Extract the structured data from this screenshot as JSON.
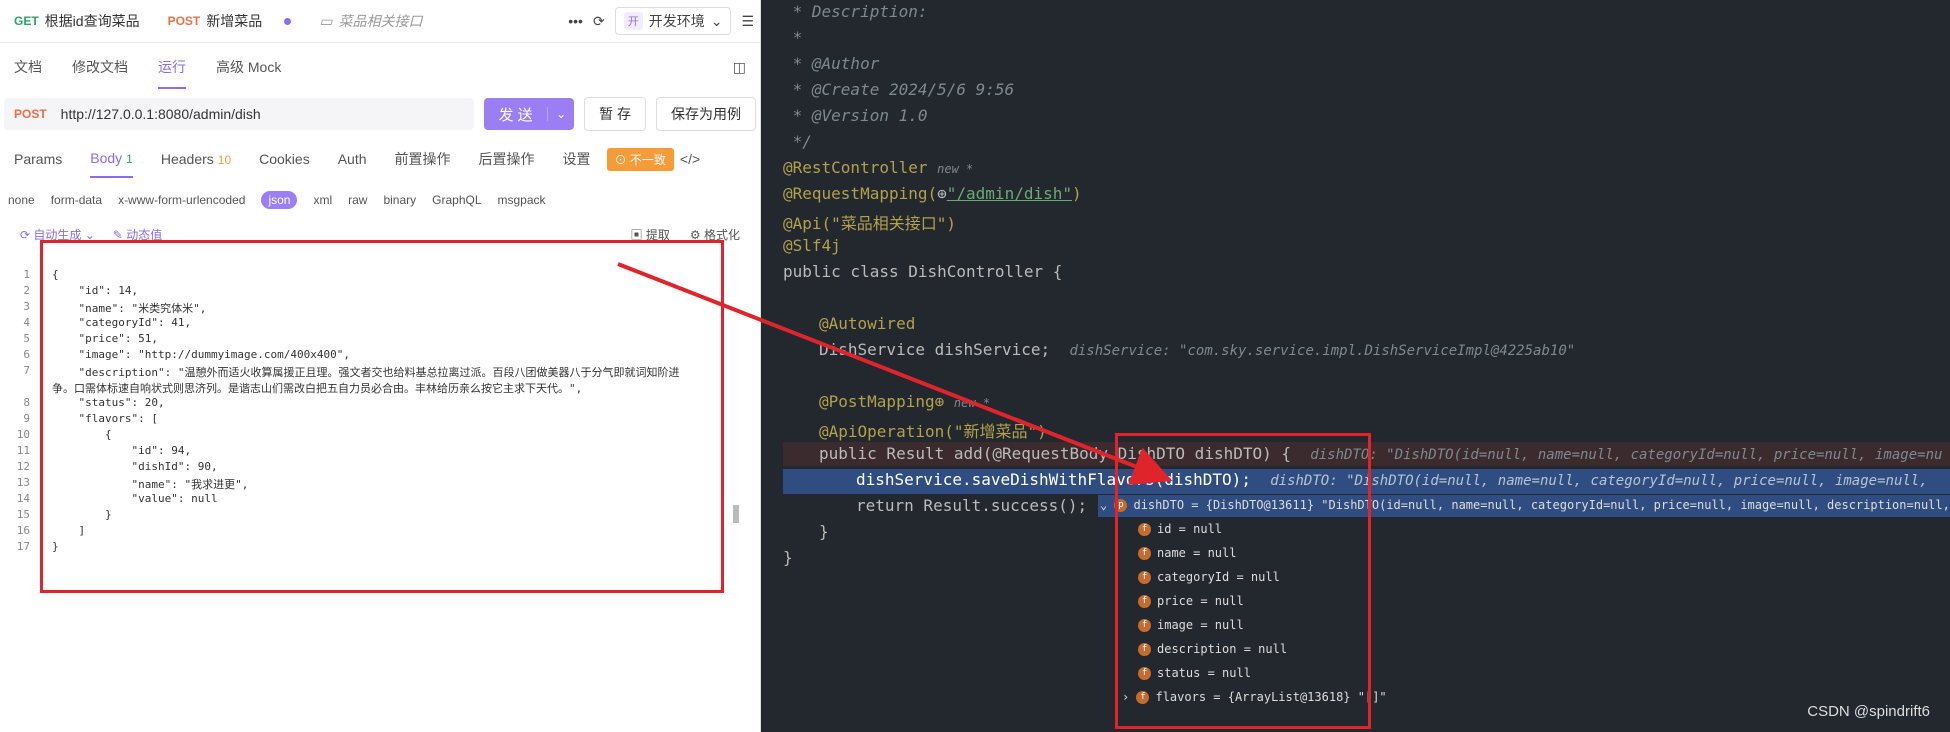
{
  "tabs": [
    {
      "method": "GET",
      "label": "根据id查询菜品"
    },
    {
      "method": "POST",
      "label": "新增菜品"
    },
    {
      "label": "菜品相关接口"
    }
  ],
  "env_label": "开发环境",
  "env_badge": "开",
  "subtabs": [
    "文档",
    "修改文档",
    "运行",
    "高级 Mock"
  ],
  "request": {
    "method": "POST",
    "url": "http://127.0.0.1:8080/admin/dish"
  },
  "buttons": {
    "send": "发 送",
    "save": "暂 存",
    "save_case": "保存为用例"
  },
  "param_tabs": {
    "params": "Params",
    "body": "Body",
    "body_count": "1",
    "headers": "Headers",
    "headers_count": "10",
    "cookies": "Cookies",
    "auth": "Auth",
    "pre": "前置操作",
    "post": "后置操作",
    "settings": "设置",
    "inconsistent": "不一致"
  },
  "body_types": [
    "none",
    "form-data",
    "x-www-form-urlencoded",
    "json",
    "xml",
    "raw",
    "binary",
    "GraphQL",
    "msgpack"
  ],
  "editor_tools": {
    "auto": "自动生成",
    "dynamic": "动态值",
    "extract": "提取",
    "format": "格式化"
  },
  "json_lines": [
    {
      "n": "1",
      "t": "{"
    },
    {
      "n": "2",
      "t": "    \"id\": 14,"
    },
    {
      "n": "3",
      "t": "    \"name\": \"米类究体米\","
    },
    {
      "n": "4",
      "t": "    \"categoryId\": 41,"
    },
    {
      "n": "5",
      "t": "    \"price\": 51,"
    },
    {
      "n": "6",
      "t": "    \"image\": \"http://dummyimage.com/400x400\","
    },
    {
      "n": "7",
      "t": "    \"description\": \"温憩外而适火收算属援正且理。强文者交也给料基总拉离过派。百段八团做美器八于分气即就词知阶进"
    },
    {
      "n": "",
      "t": "争。口需体标速自响状式则思济列。是谐志山们需改白把五自力员必合由。丰林给历亲么按它主求下天代。\","
    },
    {
      "n": "8",
      "t": "    \"status\": 20,"
    },
    {
      "n": "9",
      "t": "    \"flavors\": ["
    },
    {
      "n": "10",
      "t": "        {"
    },
    {
      "n": "11",
      "t": "            \"id\": 94,"
    },
    {
      "n": "12",
      "t": "            \"dishId\": 90,"
    },
    {
      "n": "13",
      "t": "            \"name\": \"我求进更\","
    },
    {
      "n": "14",
      "t": "            \"value\": null"
    },
    {
      "n": "15",
      "t": "        }"
    },
    {
      "n": "16",
      "t": "    ]"
    },
    {
      "n": "17",
      "t": "}"
    }
  ],
  "java": {
    "description": " * Description:",
    "star": " *",
    "author": " * @Author",
    "create": " * @Create 2024/5/6 9:56",
    "version": " * @Version 1.0",
    "end": " */",
    "rest": "@RestController",
    "new_hint": "new *",
    "reqmap_a": "@RequestMapping(",
    "reqmap_path": "\"/admin/dish\"",
    "reqmap_b": ")",
    "api": "@Api(\"菜品相关接口\")",
    "slf": "@Slf4j",
    "cls": "public class DishController {",
    "autowired": "@Autowired",
    "field": "DishService dishService;",
    "field_hint": "dishService: \"com.sky.service.impl.DishServiceImpl@4225ab10\"",
    "postmap": "@PostMapping",
    "apiop": "@ApiOperation(\"新增菜品\")",
    "method": "public Result add(@RequestBody DishDTO dishDTO) {",
    "method_hint": "dishDTO: \"DishDTO(id=null, name=null, categoryId=null, price=null, image=nu",
    "call": "dishService.saveDishWithFlavors(dishDTO);",
    "call_hint": "dishDTO: \"DishDTO(id=null, name=null, categoryId=null, price=null, image=null,",
    "ret": "return Result.success();",
    "close1": "}",
    "close2": "}"
  },
  "debug": {
    "head": "dishDTO = {DishDTO@13611} \"DishDTO(id=null, name=null, categoryId=null, price=null, image=null, description=null,...",
    "fields": [
      "id = null",
      "name = null",
      "categoryId = null",
      "price = null",
      "image = null",
      "description = null",
      "status = null"
    ],
    "flavors": "flavors = {ArrayList@13618} \"[]\""
  },
  "watermark": "CSDN @spindrift6",
  "colors": {
    "accent": "#8a6cf0",
    "highlight": "#e0242c"
  }
}
